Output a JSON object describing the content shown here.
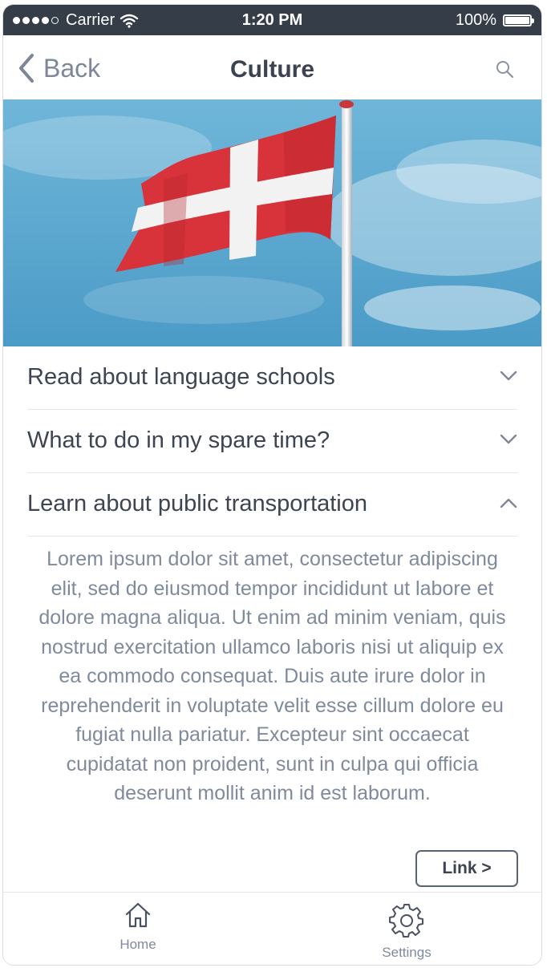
{
  "status_bar": {
    "carrier": "Carrier",
    "time": "1:20 PM",
    "battery": "100%"
  },
  "nav": {
    "back_label": "Back",
    "title": "Culture"
  },
  "accordion": {
    "items": [
      {
        "label": "Read about language schools",
        "state": "collapsed"
      },
      {
        "label": "What to do in my spare time?",
        "state": "collapsed"
      },
      {
        "label": "Learn about public transportation",
        "state": "expanded"
      }
    ],
    "expanded_text": "Lorem ipsum dolor sit amet, consectetur adipiscing elit, sed do eiusmod tempor incididunt ut labore et dolore magna aliqua. Ut enim ad minim veniam, quis nostrud exercitation ullamco laboris nisi ut aliquip ex ea commodo consequat. Duis aute irure dolor in reprehenderit in voluptate velit esse cillum dolore eu fugiat nulla pariatur. Excepteur sint occaecat cupidatat non proident, sunt in culpa qui officia deserunt mollit anim id est laborum."
  },
  "link_button": "Link >",
  "tab_bar": {
    "home_label": "Home",
    "settings_label": "Settings"
  },
  "icons": [
    "wifi-icon",
    "battery-icon",
    "back-chevron-icon",
    "search-icon",
    "chevron-down-icon",
    "chevron-up-icon",
    "home-icon",
    "gear-icon"
  ],
  "colors": {
    "status_bar_bg": "#343d48",
    "text_primary": "#3b4350",
    "text_muted": "#7f8a9c",
    "flag_red": "#d8323a",
    "sky": "#5ea8cf"
  }
}
